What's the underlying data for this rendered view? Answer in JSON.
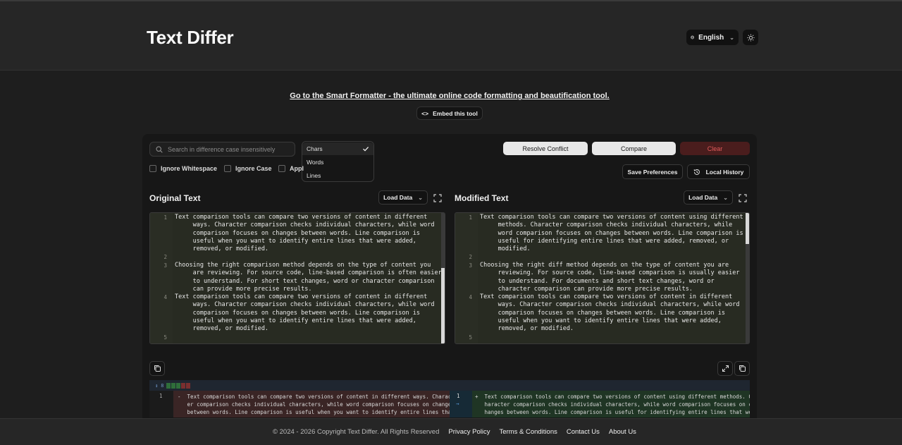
{
  "header": {
    "title": "Text Differ",
    "language": "English"
  },
  "promo": {
    "link_text": "Go to the Smart Formatter - the ultimate online code formatting and beautification tool.",
    "embed_label": "Embed this tool"
  },
  "toolbar": {
    "search_placeholder": "Search in difference case insensitively",
    "mode_options": [
      "Chars",
      "Words",
      "Lines"
    ],
    "selected_mode": "Chars",
    "options": [
      "Ignore Whitespace",
      "Ignore Case",
      "Appl"
    ],
    "resolve_label": "Resolve Conflict",
    "compare_label": "Compare",
    "clear_label": "Clear",
    "save_prefs_label": "Save Preferences",
    "history_label": "Local History"
  },
  "original": {
    "title": "Original Text",
    "load_label": "Load Data",
    "lines": [
      {
        "n": "1",
        "text": "Text comparison tools can compare two versions of content in different\n     ways. Character comparison checks individual characters, while word\n     comparison focuses on changes between words. Line comparison is\n     useful when you want to identify entire lines that were added,\n     removed, or modified."
      },
      {
        "n": "2",
        "text": ""
      },
      {
        "n": "3",
        "text": "Choosing the right comparison method depends on the type of content you\n     are reviewing. For source code, line-based comparison is often easier\n     to understand. For short text changes, word or character comparison\n     can provide more precise results."
      },
      {
        "n": "4",
        "text": "Text comparison tools can compare two versions of content in different\n     ways. Character comparison checks individual characters, while word\n     comparison focuses on changes between words. Line comparison is\n     useful when you want to identify entire lines that were added,\n     removed, or modified."
      },
      {
        "n": "5",
        "text": ""
      }
    ]
  },
  "modified": {
    "title": "Modified Text",
    "load_label": "Load Data",
    "lines": [
      {
        "n": "1",
        "text": "Text comparison tools can compare two versions of content using different\n     methods. Character comparison checks individual characters, while\n     word comparison focuses on changes between words. Line comparison is\n     useful for identifying entire lines that were added, removed, or\n     modified."
      },
      {
        "n": "2",
        "text": ""
      },
      {
        "n": "3",
        "text": "Choosing the right diff method depends on the type of content you are\n     reviewing. For source code, line-based comparison is usually easier\n     to understand. For documents and short text changes, word or\n     character comparison can provide more precise results."
      },
      {
        "n": "4",
        "text": "Text comparison tools can compare two versions of content in different\n     ways. Character comparison checks individual characters, while word\n     comparison focuses on changes between words. Line comparison is\n     useful when you want to identify entire lines that were added,\n     removed, or modified."
      },
      {
        "n": "5",
        "text": ""
      }
    ]
  },
  "diff": {
    "hunk_count": "8",
    "left_line_no": "1",
    "right_line_no": "1",
    "left_text": "-  Text comparison tools can compare two versions of content in different ways. Charact\n   er comparison checks individual characters, while word comparison focuses on changes\n   between words. Line comparison is useful when you want to identify entire lines that",
    "right_text": "+  Text comparison tools can compare two versions of content using different methods. C\n   haracter comparison checks individual characters, while word comparison focuses on c\n   hanges between words. Line comparison is useful for identifying entire lines that we"
  },
  "footer": {
    "copyright": "© 2024 - 2026 Copyright Text Differ. All Rights Reserved",
    "links": [
      "Privacy Policy",
      "Terms & Conditions",
      "Contact Us",
      "About Us"
    ]
  }
}
